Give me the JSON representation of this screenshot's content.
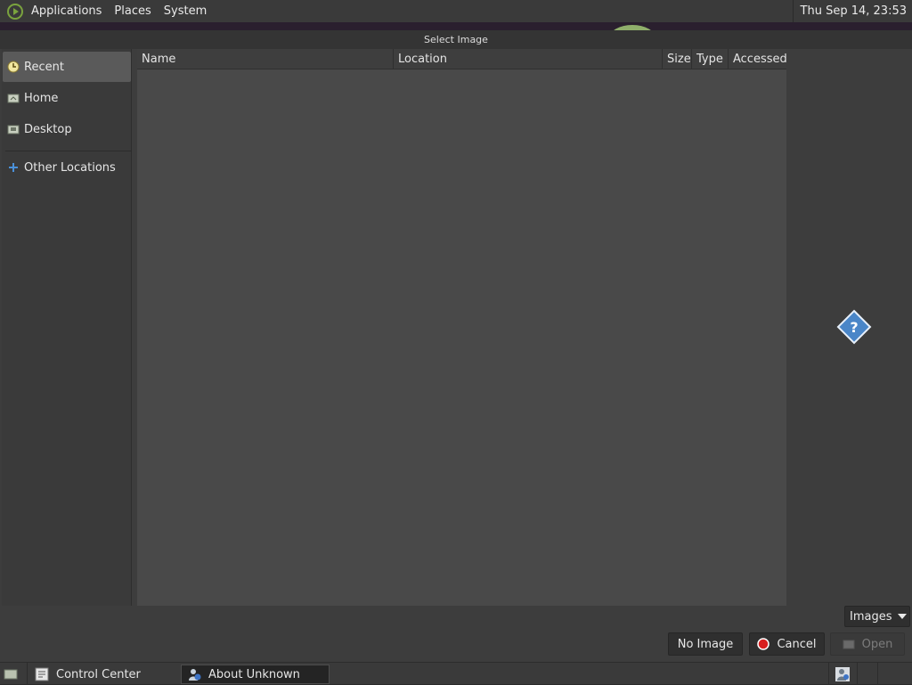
{
  "top_panel": {
    "menus": [
      "Applications",
      "Places",
      "System"
    ],
    "clock": "Thu Sep 14, 23:53"
  },
  "dialog": {
    "title": "Select Image",
    "sidebar": {
      "items": [
        {
          "label": "Recent",
          "icon": "recent-icon"
        },
        {
          "label": "Home",
          "icon": "home-folder-icon"
        },
        {
          "label": "Desktop",
          "icon": "desktop-folder-icon"
        },
        {
          "label": "Other Locations",
          "icon": "plus-icon"
        }
      ]
    },
    "columns": [
      "Name",
      "Location",
      "Size",
      "Type",
      "Accessed"
    ],
    "filter": "Images",
    "buttons": {
      "no_image": "No Image",
      "cancel": "Cancel",
      "open": "Open"
    }
  },
  "taskbar": {
    "tasks": [
      {
        "label": "Control Center",
        "icon": "control-center-icon"
      },
      {
        "label": "About Unknown",
        "icon": "user-info-icon"
      }
    ]
  },
  "colors": {
    "panel": "#3a3a3a",
    "dialog": "#3d3d3d",
    "list": "#494949",
    "cancel_red": "#d81f1f"
  }
}
